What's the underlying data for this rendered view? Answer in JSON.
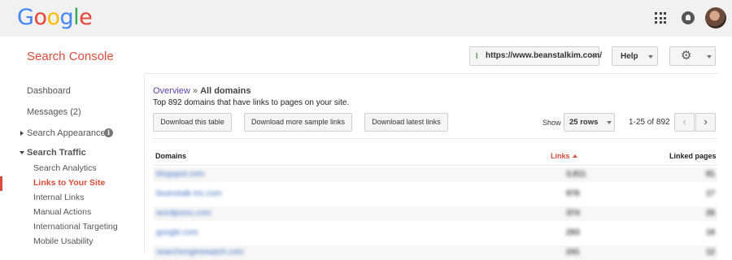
{
  "google_bar": {
    "logo_letters": [
      {
        "ch": "G",
        "color": "#4285f4"
      },
      {
        "ch": "o",
        "color": "#ea4335"
      },
      {
        "ch": "o",
        "color": "#fbbc05"
      },
      {
        "ch": "g",
        "color": "#4285f4"
      },
      {
        "ch": "l",
        "color": "#34a853"
      },
      {
        "ch": "e",
        "color": "#ea4335"
      }
    ],
    "icons": [
      "apps-grid-icon",
      "notifications-icon",
      "account-avatar"
    ]
  },
  "header": {
    "title": "Search Console",
    "site_url": "https://www.beanstalkim.com/",
    "help_label": "Help",
    "settings_icon": "gear-icon",
    "accent": "#dd4b39"
  },
  "sidebar": {
    "dashboard": "Dashboard",
    "messages": "Messages (2)",
    "search_appearance": "Search Appearance",
    "search_traffic": "Search Traffic",
    "sub_items": [
      {
        "label": "Search Analytics",
        "active": false
      },
      {
        "label": "Links to Your Site",
        "active": true
      },
      {
        "label": "Internal Links",
        "active": false
      },
      {
        "label": "Manual Actions",
        "active": false
      },
      {
        "label": "International Targeting",
        "active": false
      },
      {
        "label": "Mobile Usability",
        "active": false
      }
    ]
  },
  "main": {
    "breadcrumb_link": "Overview",
    "breadcrumb_sep": "»",
    "breadcrumb_current": "All domains",
    "subtitle": "Top 892 domains that have links to pages on your site.",
    "buttons": {
      "download_table": "Download this table",
      "download_sample": "Download more sample links",
      "download_latest": "Download latest links"
    },
    "show_label": "Show",
    "rows_value": "25 rows",
    "range": "1-25 of 892",
    "prev_icon": "‹",
    "next_icon": "›",
    "columns": {
      "domains": "Domains",
      "links": "Links",
      "linked_pages": "Linked pages"
    },
    "rows": [
      {
        "domain": "blogspot.com",
        "links": "3,811",
        "linked": "81"
      },
      {
        "domain": "beanstalk-inc.com",
        "links": "976",
        "linked": "17"
      },
      {
        "domain": "wordpress.com",
        "links": "374",
        "linked": "26"
      },
      {
        "domain": "google.com",
        "links": "293",
        "linked": "18"
      },
      {
        "domain": "searchenginewatch.com",
        "links": "241",
        "linked": "12"
      }
    ]
  }
}
